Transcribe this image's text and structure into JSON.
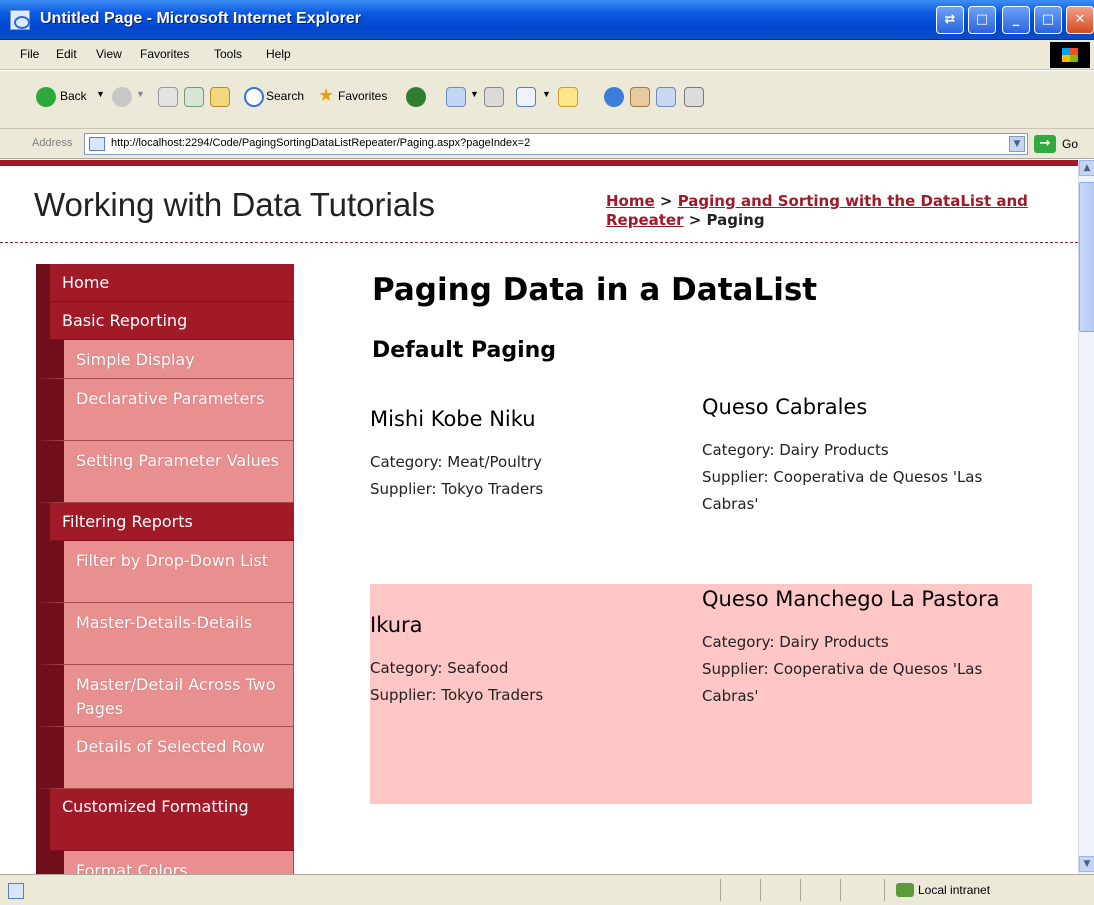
{
  "window": {
    "title": "Untitled Page - Microsoft Internet Explorer"
  },
  "menu": [
    "File",
    "Edit",
    "View",
    "Favorites",
    "Tools",
    "Help"
  ],
  "toolbar": {
    "back_label": "Back",
    "search_label": "Search",
    "favorites_label": "Favorites"
  },
  "address": {
    "label": "Address",
    "url": "http://localhost:2294/Code/PagingSortingDataListRepeater/Paging.aspx?pageIndex=2",
    "go_label": "Go"
  },
  "site": {
    "title": "Working with Data Tutorials",
    "breadcrumb": {
      "home": "Home",
      "sep1": ">",
      "section": "Paging and Sorting with the DataList and Repeater",
      "sep2": ">",
      "current": "Paging"
    }
  },
  "sidebar": {
    "items": [
      {
        "label": "Home",
        "level": 1
      },
      {
        "label": "Basic Reporting",
        "level": 1
      },
      {
        "label": "Simple Display",
        "level": 2
      },
      {
        "label": "Declarative Parameters",
        "level": 2
      },
      {
        "label": "Setting Parameter Values",
        "level": 2
      },
      {
        "label": "Filtering Reports",
        "level": 1
      },
      {
        "label": "Filter by Drop-Down List",
        "level": 2
      },
      {
        "label": "Master-Details-Details",
        "level": 2
      },
      {
        "label": "Master/Detail Across Two Pages",
        "level": 2
      },
      {
        "label": "Details of Selected Row",
        "level": 2
      },
      {
        "label": "Customized Formatting",
        "level": 1
      },
      {
        "label": "Format Colors",
        "level": 2
      }
    ]
  },
  "main": {
    "title": "Paging Data in a DataList",
    "subtitle": "Default Paging",
    "products": [
      {
        "name": "Mishi Kobe Niku",
        "category": "Category: Meat/Poultry",
        "supplier": "Supplier: Tokyo Traders"
      },
      {
        "name": "Queso Cabrales",
        "category": "Category: Dairy Products",
        "supplier": "Supplier: Cooperativa de Quesos 'Las Cabras'"
      },
      {
        "name": "Ikura",
        "category": "Category: Seafood",
        "supplier": "Supplier: Tokyo Traders"
      },
      {
        "name": "Queso Manchego La Pastora",
        "category": "Category: Dairy Products",
        "supplier": "Supplier: Cooperativa de Quesos 'Las Cabras'"
      }
    ],
    "alt_row_color": "#ffc6c6"
  },
  "status": {
    "zone": "Local intranet"
  }
}
